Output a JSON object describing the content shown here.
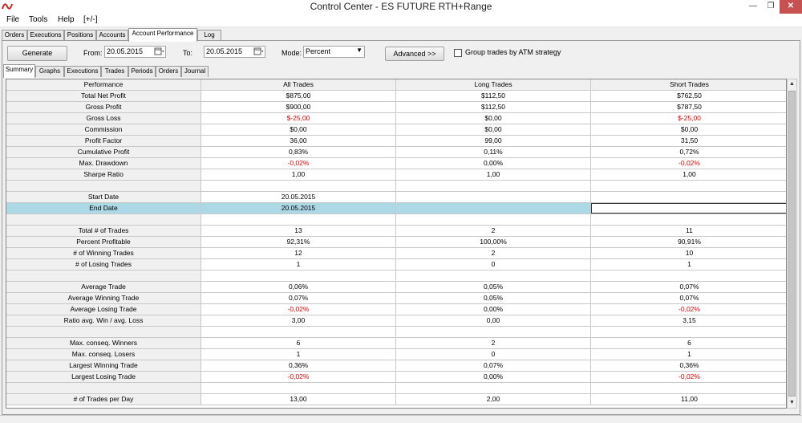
{
  "window": {
    "title": "Control Center - ES FUTURE RTH+Range"
  },
  "menu": [
    "File",
    "Tools",
    "Help",
    "[+/-]"
  ],
  "main_tabs": [
    "Orders",
    "Executions",
    "Positions",
    "Accounts",
    "Account Performance",
    "Log"
  ],
  "toolbar": {
    "generate_label": "Generate",
    "from_label": "From:",
    "from_value": "20.05.2015",
    "to_label": "To:",
    "to_value": "20.05.2015",
    "mode_label": "Mode:",
    "mode_value": "Percent",
    "advanced_label": "Advanced >>",
    "group_label": "Group trades by ATM strategy"
  },
  "sub_tabs": [
    "Summary",
    "Graphs",
    "Executions",
    "Trades",
    "Periods",
    "Orders",
    "Journal"
  ],
  "table": {
    "headers": [
      "Performance",
      "All Trades",
      "Long Trades",
      "Short Trades"
    ],
    "rows": [
      [
        "Total Net Profit",
        "$875,00",
        "$112,50",
        "$762,50"
      ],
      [
        "Gross Profit",
        "$900,00",
        "$112,50",
        "$787,50"
      ],
      [
        "Gross Loss",
        "$-25,00",
        "$0,00",
        "$-25,00"
      ],
      [
        "Commission",
        "$0,00",
        "$0,00",
        "$0,00"
      ],
      [
        "Profit Factor",
        "36,00",
        "99,00",
        "31,50"
      ],
      [
        "Cumulative Profit",
        "0,83%",
        "0,11%",
        "0,72%"
      ],
      [
        "Max. Drawdown",
        "-0,02%",
        "0,00%",
        "-0,02%"
      ],
      [
        "Sharpe Ratio",
        "1,00",
        "1,00",
        "1,00"
      ],
      [
        "",
        "",
        "",
        ""
      ],
      [
        "Start Date",
        "20.05.2015",
        "",
        ""
      ],
      [
        "End Date",
        "20.05.2015",
        "",
        ""
      ],
      [
        "",
        "",
        "",
        ""
      ],
      [
        "Total # of Trades",
        "13",
        "2",
        "11"
      ],
      [
        "Percent Profitable",
        "92,31%",
        "100,00%",
        "90,91%"
      ],
      [
        "# of Winning Trades",
        "12",
        "2",
        "10"
      ],
      [
        "# of Losing Trades",
        "1",
        "0",
        "1"
      ],
      [
        "",
        "",
        "",
        ""
      ],
      [
        "Average Trade",
        "0,06%",
        "0,05%",
        "0,07%"
      ],
      [
        "Average Winning Trade",
        "0,07%",
        "0,05%",
        "0,07%"
      ],
      [
        "Average Losing Trade",
        "-0,02%",
        "0,00%",
        "-0,02%"
      ],
      [
        "Ratio avg. Win / avg. Loss",
        "3,00",
        "0,00",
        "3,15"
      ],
      [
        "",
        "",
        "",
        ""
      ],
      [
        "Max. conseq. Winners",
        "6",
        "2",
        "6"
      ],
      [
        "Max. conseq. Losers",
        "1",
        "0",
        "1"
      ],
      [
        "Largest Winning Trade",
        "0,36%",
        "0,07%",
        "0,36%"
      ],
      [
        "Largest Losing Trade",
        "-0,02%",
        "0,00%",
        "-0,02%"
      ],
      [
        "",
        "",
        "",
        ""
      ],
      [
        "# of Trades per Day",
        "13,00",
        "2,00",
        "11,00"
      ]
    ]
  },
  "colors": {
    "negative": "#e00000",
    "selection": "#add8e6"
  },
  "icons": {
    "app": "app-logo-icon",
    "calendar": "calendar-icon"
  }
}
